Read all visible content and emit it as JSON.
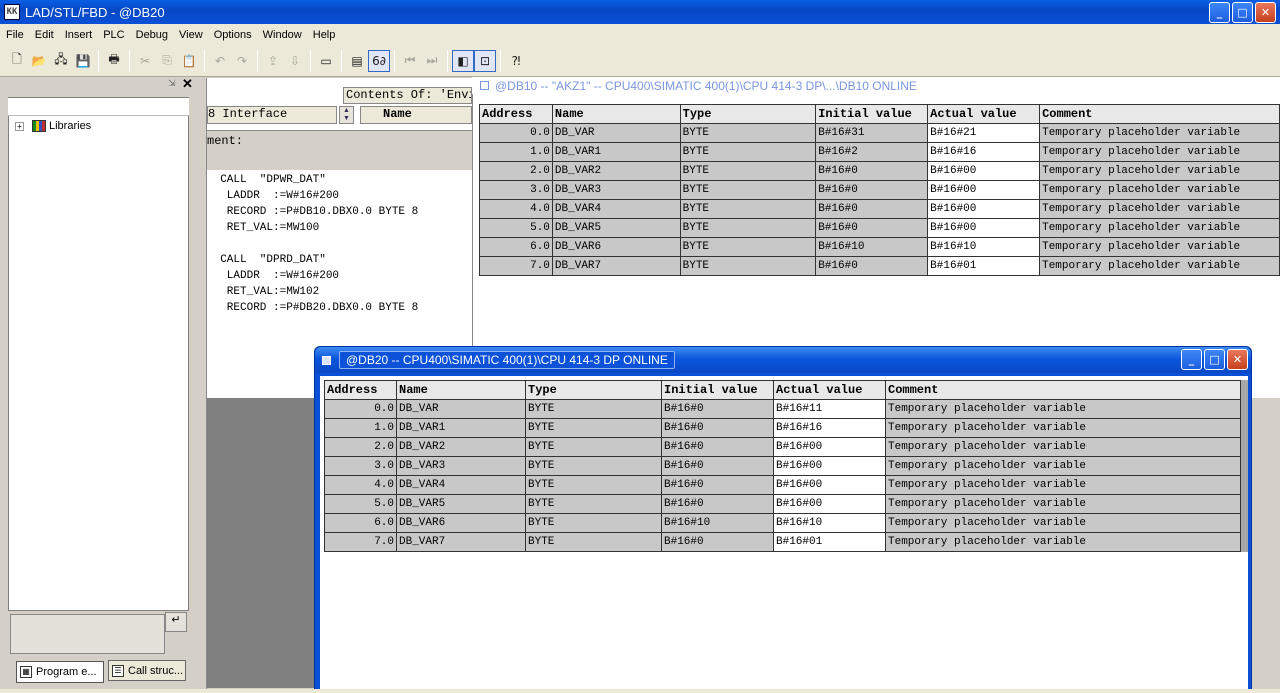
{
  "app": {
    "title": "LAD/STL/FBD  - @DB20",
    "icon_text": "KK"
  },
  "title_buttons": {
    "min": "_",
    "max": "□",
    "close": "✕"
  },
  "menu": [
    "File",
    "Edit",
    "Insert",
    "PLC",
    "Debug",
    "View",
    "Options",
    "Window",
    "Help"
  ],
  "toolbar_icons": [
    "new-icon",
    "open-icon",
    "accessible-nodes-icon",
    "save-icon",
    "print-icon",
    "cut-icon",
    "copy-icon",
    "paste-icon",
    "undo-icon",
    "redo-icon",
    "load-icon",
    "download-icon",
    "overview-icon",
    "monitor-icon",
    "glasses-icon",
    "breakpoint-prev-icon",
    "breakpoint-next-icon",
    "window-arrange-icon",
    "zoom-icon",
    "help-icon"
  ],
  "left_pane": {
    "tree_item": "Libraries",
    "tabs": [
      "Program e...",
      "Call struc..."
    ],
    "detail_btn": "↵",
    "plus": "+",
    "min": "⇲",
    "close": "✕"
  },
  "mid_pane": {
    "contents_label": "Contents Of: 'Envi",
    "interface_label": "8 Interface",
    "name_header": "Name",
    "comment_label": "ment:",
    "code": [
      "  CALL  \"DPWR_DAT\"",
      "   LADDR  :=W#16#200",
      "   RECORD :=P#DB10.DBX0.0 BYTE 8",
      "   RET_VAL:=MW100",
      "",
      "  CALL  \"DPRD_DAT\"",
      "   LADDR  :=W#16#200",
      "   RET_VAL:=MW102",
      "   RECORD :=P#DB20.DBX0.0 BYTE 8"
    ]
  },
  "db10": {
    "title": "@DB10 -- \"AKZ1\" -- CPU400\\SIMATIC 400(1)\\CPU 414-3 DP\\...\\DB10  ONLINE",
    "headers": [
      "Address",
      "Name",
      "Type",
      "Initial value",
      "Actual value",
      "Comment"
    ],
    "rows": [
      [
        "0.0",
        "DB_VAR",
        "BYTE",
        "B#16#31",
        "B#16#21",
        "Temporary placeholder variable"
      ],
      [
        "1.0",
        "DB_VAR1",
        "BYTE",
        "B#16#2",
        "B#16#16",
        "Temporary placeholder variable"
      ],
      [
        "2.0",
        "DB_VAR2",
        "BYTE",
        "B#16#0",
        "B#16#00",
        "Temporary placeholder variable"
      ],
      [
        "3.0",
        "DB_VAR3",
        "BYTE",
        "B#16#0",
        "B#16#00",
        "Temporary placeholder variable"
      ],
      [
        "4.0",
        "DB_VAR4",
        "BYTE",
        "B#16#0",
        "B#16#00",
        "Temporary placeholder variable"
      ],
      [
        "5.0",
        "DB_VAR5",
        "BYTE",
        "B#16#0",
        "B#16#00",
        "Temporary placeholder variable"
      ],
      [
        "6.0",
        "DB_VAR6",
        "BYTE",
        "B#16#10",
        "B#16#10",
        "Temporary placeholder variable"
      ],
      [
        "7.0",
        "DB_VAR7",
        "BYTE",
        "B#16#0",
        "B#16#01",
        "Temporary placeholder variable"
      ]
    ]
  },
  "db20": {
    "title": "@DB20 -- CPU400\\SIMATIC 400(1)\\CPU 414-3 DP  ONLINE",
    "headers": [
      "Address",
      "Name",
      "Type",
      "Initial value",
      "Actual value",
      "Comment"
    ],
    "rows": [
      [
        "0.0",
        "DB_VAR",
        "BYTE",
        "B#16#0",
        "B#16#11",
        "Temporary placeholder variable"
      ],
      [
        "1.0",
        "DB_VAR1",
        "BYTE",
        "B#16#0",
        "B#16#16",
        "Temporary placeholder variable"
      ],
      [
        "2.0",
        "DB_VAR2",
        "BYTE",
        "B#16#0",
        "B#16#00",
        "Temporary placeholder variable"
      ],
      [
        "3.0",
        "DB_VAR3",
        "BYTE",
        "B#16#0",
        "B#16#00",
        "Temporary placeholder variable"
      ],
      [
        "4.0",
        "DB_VAR4",
        "BYTE",
        "B#16#0",
        "B#16#00",
        "Temporary placeholder variable"
      ],
      [
        "5.0",
        "DB_VAR5",
        "BYTE",
        "B#16#0",
        "B#16#00",
        "Temporary placeholder variable"
      ],
      [
        "6.0",
        "DB_VAR6",
        "BYTE",
        "B#16#10",
        "B#16#10",
        "Temporary placeholder variable"
      ],
      [
        "7.0",
        "DB_VAR7",
        "BYTE",
        "B#16#0",
        "B#16#01",
        "Temporary placeholder variable"
      ]
    ]
  },
  "colors": {
    "title_blue": "#0a50d6",
    "inactive_title": "#7a96df",
    "table_bg": "#c8c8c8"
  }
}
